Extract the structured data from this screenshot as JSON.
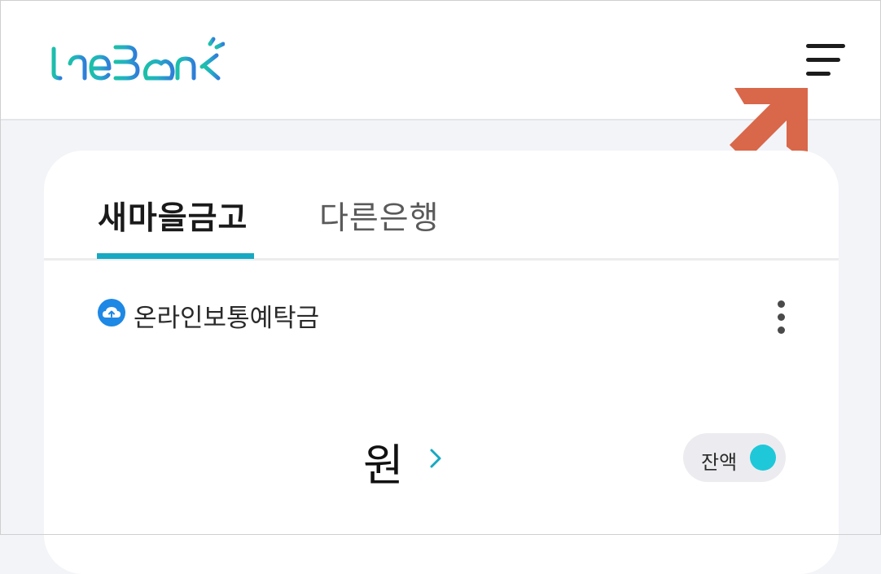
{
  "header": {
    "logo_text": "theBank",
    "menu_icon": "hamburger-menu-icon",
    "annotation_color": "#d9674a"
  },
  "tabs": [
    {
      "label": "새마을금고",
      "active": true
    },
    {
      "label": "다른은행",
      "active": false
    }
  ],
  "account": {
    "icon": "cloud-upload-icon",
    "name": "온라인보통예탁금",
    "amount": "원",
    "balance_toggle_label": "잔액"
  },
  "colors": {
    "accent": "#17a9c2",
    "toggle": "#1ec8d9",
    "logo_teal": "#20b8b0",
    "logo_blue": "#2e7fd8"
  }
}
